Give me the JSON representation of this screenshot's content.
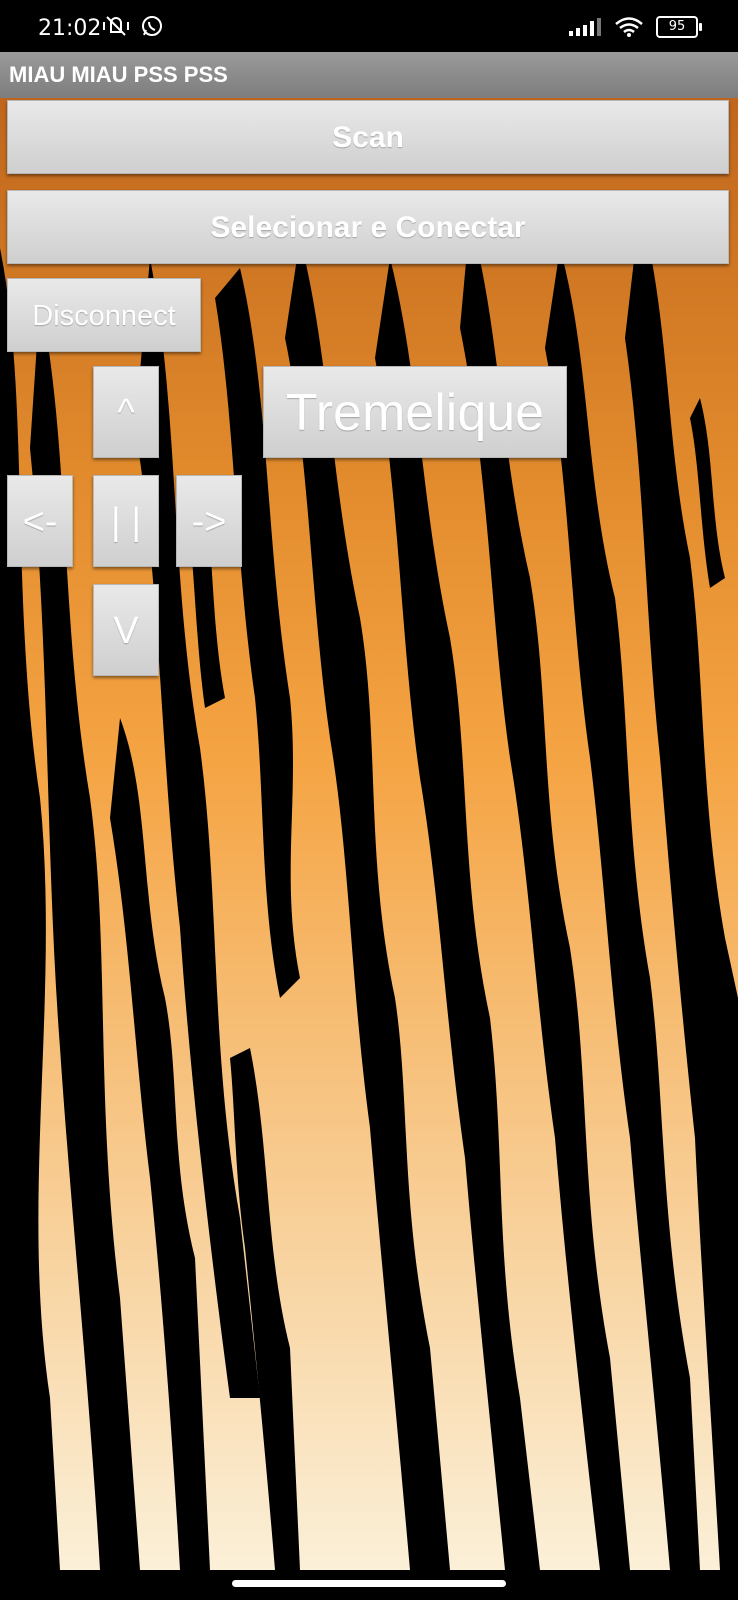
{
  "status_bar": {
    "time": "21:02",
    "battery": "95",
    "icons_left": [
      "mute-vibrate-icon",
      "whatsapp-icon"
    ],
    "icons_right": [
      "signal-icon",
      "wifi-icon",
      "battery-icon"
    ]
  },
  "app": {
    "title": "MIAU MIAU PSS PSS"
  },
  "buttons": {
    "scan": "Scan",
    "connect": "Selecionar e Conectar",
    "disconnect": "Disconnect",
    "up": "^",
    "left": "<-",
    "stop": "| |",
    "right": "->",
    "down": "V",
    "tremelique": "Tremelique"
  },
  "colors": {
    "background_top": "#c0661c",
    "background_mid": "#f5a443",
    "background_bottom": "#fbf0d8",
    "stripes": "#000000",
    "button": "#dcdcdc",
    "button_text": "#ffffff",
    "title_bar": "#8a8a8a"
  }
}
